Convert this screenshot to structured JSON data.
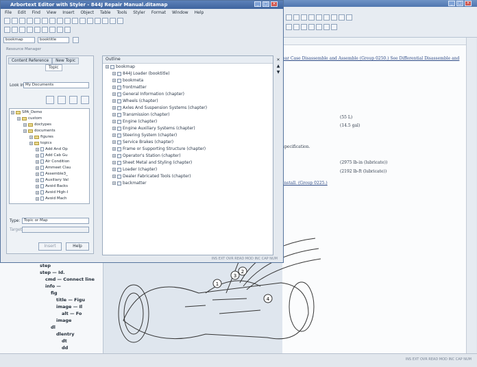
{
  "window": {
    "title": "Arbortext Editor with Styler - 844J Repair Manual.ditamap",
    "menus": [
      "File",
      "Edit",
      "Find",
      "View",
      "Insert",
      "Object",
      "Table",
      "Tools",
      "Styler",
      "Format",
      "Window",
      "Help"
    ],
    "element_combo": "bookmap",
    "attr_combo": "booktitle"
  },
  "left_panel": {
    "header": "Resource Manager",
    "tabs": [
      "Content Reference",
      "New Topic",
      "Topic"
    ],
    "look_in_label": "Look in:",
    "look_in_value": "My Documents",
    "tree": [
      {
        "label": "SPA_Demo",
        "depth": 0,
        "kind": "folder"
      },
      {
        "label": "custom",
        "depth": 1,
        "kind": "folder"
      },
      {
        "label": "doctypes",
        "depth": 2,
        "kind": "folder"
      },
      {
        "label": "documents",
        "depth": 2,
        "kind": "folder"
      },
      {
        "label": "figures",
        "depth": 3,
        "kind": "folder"
      },
      {
        "label": "topics",
        "depth": 3,
        "kind": "folder"
      },
      {
        "label": "Add And Op",
        "depth": 4,
        "kind": "file"
      },
      {
        "label": "Add Cab Gu",
        "depth": 4,
        "kind": "file"
      },
      {
        "label": "Air Condition",
        "depth": 4,
        "kind": "file"
      },
      {
        "label": "Ammeet Clau",
        "depth": 4,
        "kind": "file"
      },
      {
        "label": "Assemble3_",
        "depth": 4,
        "kind": "file"
      },
      {
        "label": "Auxiliary Val",
        "depth": 4,
        "kind": "file"
      },
      {
        "label": "Avoid Backs",
        "depth": 4,
        "kind": "file"
      },
      {
        "label": "Avoid High-I",
        "depth": 4,
        "kind": "file"
      },
      {
        "label": "Avoid Mach",
        "depth": 4,
        "kind": "file"
      }
    ],
    "type_label": "Type:",
    "type_value": "Topic or Map",
    "target_label": "Target:",
    "insert_button": "Insert",
    "help_button": "Help"
  },
  "outline": {
    "header": "Outline",
    "items": [
      {
        "label": "bookmap",
        "depth": 0
      },
      {
        "label": "844J Loader (booktitle)",
        "depth": 1
      },
      {
        "label": "bookmeta",
        "depth": 1
      },
      {
        "label": "frontmatter",
        "depth": 1
      },
      {
        "label": "General Information (chapter)",
        "depth": 1
      },
      {
        "label": "Wheels (chapter)",
        "depth": 1
      },
      {
        "label": "Axles And Suspension Systems (chapter)",
        "depth": 1
      },
      {
        "label": "Transmission (chapter)",
        "depth": 1
      },
      {
        "label": "Engine (chapter)",
        "depth": 1
      },
      {
        "label": "Engine Auxiliary Systems (chapter)",
        "depth": 1
      },
      {
        "label": "Steering System (chapter)",
        "depth": 1
      },
      {
        "label": "Service Brakes (chapter)",
        "depth": 1
      },
      {
        "label": "Frame or Supporting Structure (chapter)",
        "depth": 1
      },
      {
        "label": "Operator's Station (chapter)",
        "depth": 1
      },
      {
        "label": "Sheet Metal and Styling (chapter)",
        "depth": 1
      },
      {
        "label": "Loader (chapter)",
        "depth": 1
      },
      {
        "label": "Dealer Fabricated Tools (chapter)",
        "depth": 1
      },
      {
        "label": "backmatter",
        "depth": 1
      }
    ],
    "status": "INS EXT OVR READ MOD INC CAP NUM"
  },
  "document": {
    "lines": [
      {
        "text": "ear Case Disassemble and Assemble (Group 0250.) See Differential Disassemble and",
        "link": true
      },
      {
        "text": "(55 L)",
        "link": false
      },
      {
        "text": "(14.5 gal)",
        "link": false
      },
      {
        "text": "specification.",
        "link": false
      },
      {
        "text": "(2975 lb-in (lubricate))",
        "link": false
      },
      {
        "text": "(2192 lb-ft (lubricate))",
        "link": false
      },
      {
        "text": "Install. (Group 0225.)",
        "link": true
      }
    ],
    "figure_callouts": [
      "1",
      "2",
      "3",
      "4"
    ]
  },
  "structure_tree": [
    {
      "label": "step",
      "depth": 0
    },
    {
      "label": "step — Id.",
      "depth": 0
    },
    {
      "label": "cmd — Connect line",
      "depth": 1
    },
    {
      "label": "info —",
      "depth": 1
    },
    {
      "label": "fig",
      "depth": 2
    },
    {
      "label": "title — Figu",
      "depth": 3
    },
    {
      "label": "image — Il",
      "depth": 3
    },
    {
      "label": "alt — Fo",
      "depth": 4
    },
    {
      "label": "image",
      "depth": 3
    },
    {
      "label": "dl",
      "depth": 2
    },
    {
      "label": "dlentry",
      "depth": 3
    },
    {
      "label": "dt",
      "depth": 4
    },
    {
      "label": "dd",
      "depth": 4
    }
  ],
  "bottom_status": "INS EXT OVR READ MOD INC CAP NUM"
}
